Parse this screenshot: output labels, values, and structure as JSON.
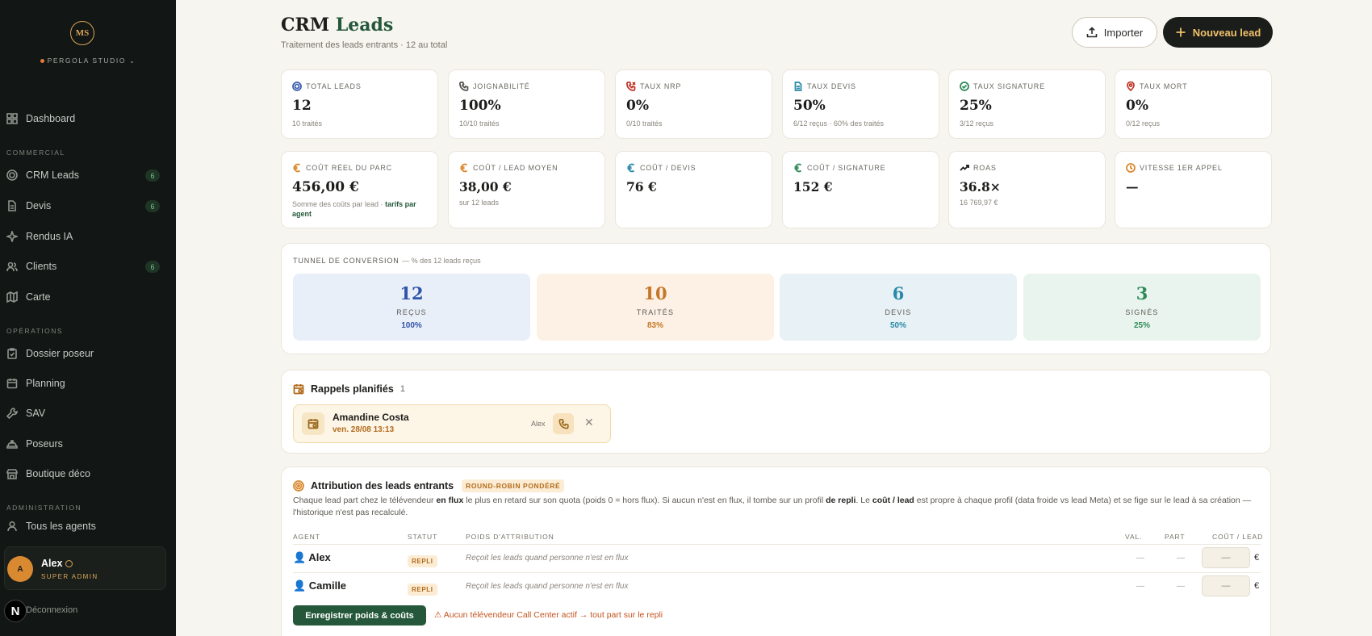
{
  "sidebar": {
    "logo_initials": "MS",
    "studio_name": "PERGOLA STUDIO",
    "studio_chevron": "⌄",
    "nav": [
      {
        "label": "Dashboard",
        "icon": "grid-icon"
      },
      {
        "label": "CRM Leads",
        "icon": "target-icon",
        "badge": "6"
      },
      {
        "label": "Devis",
        "icon": "document-icon",
        "badge": "6"
      },
      {
        "label": "Rendus IA",
        "icon": "sparkle-icon"
      },
      {
        "label": "Clients",
        "icon": "users-icon",
        "badge": "6"
      },
      {
        "label": "Carte",
        "icon": "map-icon"
      },
      {
        "label": "Dossier poseur",
        "icon": "clipboard-icon"
      },
      {
        "label": "Planning",
        "icon": "calendar-icon"
      },
      {
        "label": "SAV",
        "icon": "wrench-icon"
      },
      {
        "label": "Poseurs",
        "icon": "hardhat-icon"
      },
      {
        "label": "Boutique déco",
        "icon": "shop-icon"
      },
      {
        "label": "Tous les agents",
        "icon": "user-icon"
      }
    ],
    "sections": {
      "commercial": "COMMERCIAL",
      "operations": "OPÉRATIONS",
      "administration": "ADMINISTRATION"
    },
    "user": {
      "initial": "A",
      "name": "Alex",
      "role": "SUPER ADMIN"
    },
    "logout": "Déconnexion",
    "n_badge": "N"
  },
  "header": {
    "title_main": "CRM",
    "title_accent": "Leads",
    "subtitle": "Traitement des leads entrants · 12 au total",
    "import_label": "Importer",
    "new_lead_label": "Nouveau lead"
  },
  "kpis_row1": [
    {
      "label": "TOTAL LEADS",
      "value": "12",
      "sub": "10 traités",
      "icon": "target-icon",
      "color": "#3b5fb0"
    },
    {
      "label": "JOIGNABILITÉ",
      "value": "100%",
      "sub": "10/10 traités",
      "icon": "phone-icon",
      "color": "#5a5751"
    },
    {
      "label": "TAUX NRP",
      "value": "0%",
      "sub": "0/10 traités",
      "icon": "phone-missed-icon",
      "color": "#c0392b"
    },
    {
      "label": "TAUX DEVIS",
      "value": "50%",
      "sub": "6/12 reçus · 60% des traités",
      "icon": "document-icon",
      "color": "#2a8aa8"
    },
    {
      "label": "TAUX SIGNATURE",
      "value": "25%",
      "sub": "3/12 reçus",
      "icon": "check-circle-icon",
      "color": "#2e8b57"
    },
    {
      "label": "TAUX MORT",
      "value": "0%",
      "sub": "0/12 reçus",
      "icon": "pin-icon",
      "color": "#c0392b"
    }
  ],
  "kpis_row2": [
    {
      "label": "COÛT RÉEL DU PARC",
      "value": "456,00 €",
      "sub": "Somme des coûts par lead ·",
      "sub_bold": "tarifs par agent",
      "icon": "euro-icon",
      "color": "#d9892f"
    },
    {
      "label": "COÛT / LEAD MOYEN",
      "value": "38,00 €",
      "sub": "sur 12 leads",
      "icon": "euro-icon",
      "color": "#d9892f"
    },
    {
      "label": "COÛT / DEVIS",
      "value": "76 €",
      "sub": "",
      "icon": "euro-icon",
      "color": "#2a8aa8"
    },
    {
      "label": "COÛT / SIGNATURE",
      "value": "152 €",
      "sub": "",
      "icon": "euro-icon",
      "color": "#2e8b57"
    },
    {
      "label": "ROAS",
      "value": "36.8×",
      "sub": "16 769,97 €",
      "icon": "trend-up-icon",
      "color": "#1d1d1b"
    },
    {
      "label": "VITESSE 1ER APPEL",
      "value": "—",
      "sub": "",
      "icon": "clock-icon",
      "color": "#d9892f"
    }
  ],
  "funnel": {
    "title": "TUNNEL DE CONVERSION",
    "subtitle": "— % des 12 leads reçus",
    "stages": [
      {
        "value": "12",
        "label": "REÇUS",
        "pct": "100%",
        "bg": "#e9eff9",
        "color": "#2f54a8"
      },
      {
        "value": "10",
        "label": "TRAITÉS",
        "pct": "83%",
        "bg": "#fcf1e4",
        "color": "#c7772a"
      },
      {
        "value": "6",
        "label": "DEVIS",
        "pct": "50%",
        "bg": "#e8f1f5",
        "color": "#2a8aa8"
      },
      {
        "value": "3",
        "label": "SIGNÉS",
        "pct": "25%",
        "bg": "#eaf4ee",
        "color": "#2e8b57"
      }
    ]
  },
  "rappels": {
    "title": "Rappels planifiés",
    "count": "1",
    "item": {
      "name": "Amandine Costa",
      "date": "ven. 28/08 13:13",
      "agent": "Alex"
    }
  },
  "attribution": {
    "title": "Attribution des leads entrants",
    "badge": "ROUND-ROBIN PONDÉRÉ",
    "desc_1": "Chaque lead part chez le télévendeur ",
    "desc_b1": "en flux",
    "desc_2": " le plus en retard sur son quota (poids 0 = hors flux). Si aucun n'est en flux, il tombe sur un profil ",
    "desc_b2": "de repli",
    "desc_3": ". Le ",
    "desc_b3": "coût / lead",
    "desc_4": " est propre à chaque profil (data froide vs lead Meta) et se fige sur le lead à sa création — l'historique n'est pas recalculé.",
    "headers": {
      "agent": "AGENT",
      "statut": "STATUT",
      "poids": "POIDS D'ATTRIBUTION",
      "val": "VAL.",
      "part": "PART",
      "cout": "COÛT / LEAD"
    },
    "rows": [
      {
        "agent": "👤 Alex",
        "statut": "REPLI",
        "poids": "Reçoit les leads quand personne n'est en flux",
        "val": "—",
        "part": "—",
        "cout": "—",
        "currency": "€"
      },
      {
        "agent": "👤 Camille",
        "statut": "REPLI",
        "poids": "Reçoit les leads quand personne n'est en flux",
        "val": "—",
        "part": "—",
        "cout": "—",
        "currency": "€"
      }
    ],
    "save_label": "Enregistrer poids & coûts",
    "warning": "⚠ Aucun télévendeur Call Center actif → tout part sur le repli"
  }
}
